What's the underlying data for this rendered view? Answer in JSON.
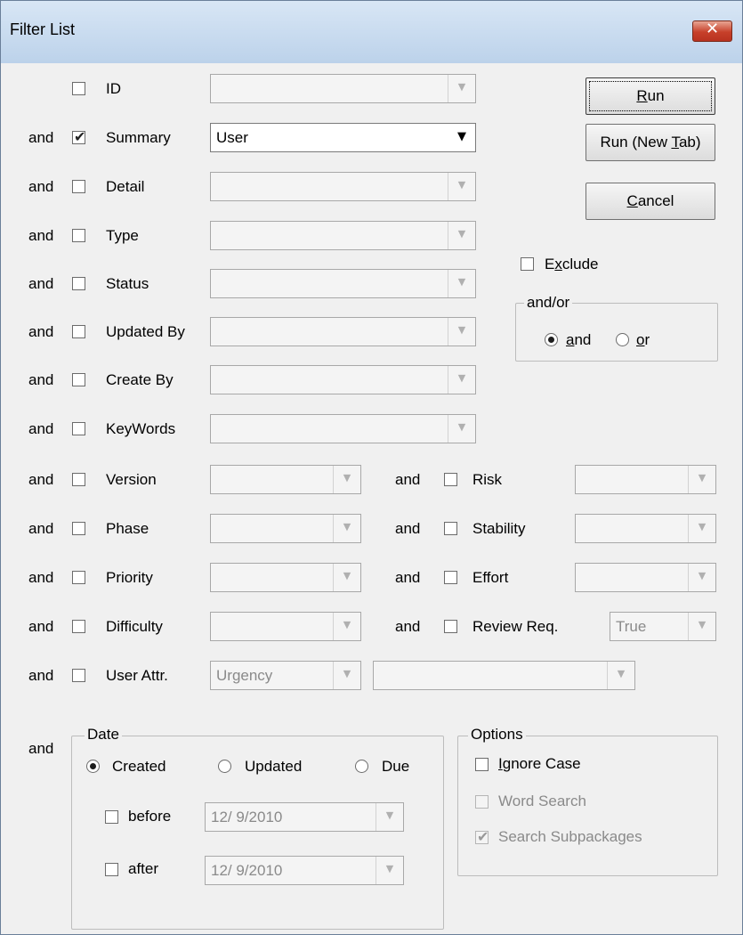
{
  "window": {
    "title": "Filter List",
    "close_glyph": "✕"
  },
  "glyphs": {
    "check": "✔",
    "arrow": "▼"
  },
  "rows": [
    {
      "conj": "",
      "label": "ID",
      "checked": false,
      "value": ""
    },
    {
      "conj": "and",
      "label": "Summary",
      "checked": true,
      "value": "User"
    },
    {
      "conj": "and",
      "label": "Detail",
      "checked": false,
      "value": ""
    },
    {
      "conj": "and",
      "label": "Type",
      "checked": false,
      "value": ""
    },
    {
      "conj": "and",
      "label": "Status",
      "checked": false,
      "value": ""
    },
    {
      "conj": "and",
      "label": "Updated By",
      "checked": false,
      "value": ""
    },
    {
      "conj": "and",
      "label": "Create By",
      "checked": false,
      "value": ""
    },
    {
      "conj": "and",
      "label": "KeyWords",
      "checked": false,
      "value": ""
    }
  ],
  "left_rows": [
    {
      "conj": "and",
      "label": "Version",
      "checked": false,
      "value": ""
    },
    {
      "conj": "and",
      "label": "Phase",
      "checked": false,
      "value": ""
    },
    {
      "conj": "and",
      "label": "Priority",
      "checked": false,
      "value": ""
    },
    {
      "conj": "and",
      "label": "Difficulty",
      "checked": false,
      "value": ""
    }
  ],
  "right_rows": [
    {
      "conj": "and",
      "label": "Risk",
      "checked": false,
      "value": ""
    },
    {
      "conj": "and",
      "label": "Stability",
      "checked": false,
      "value": ""
    },
    {
      "conj": "and",
      "label": "Effort",
      "checked": false,
      "value": ""
    },
    {
      "conj": "and",
      "label": "Review Req.",
      "checked": false,
      "value": "True"
    }
  ],
  "user_attr": {
    "conj": "and",
    "label": "User Attr.",
    "checked": false,
    "attr_value": "Urgency",
    "value": ""
  },
  "buttons": {
    "run": {
      "pre": "",
      "key": "R",
      "post": "un"
    },
    "run_new_tab": {
      "pre": "Run (New ",
      "key": "T",
      "post": "ab)"
    },
    "cancel": {
      "pre": "",
      "key": "C",
      "post": "ancel"
    }
  },
  "exclude": {
    "pre": "",
    "key": "x",
    "label_pre": "E",
    "post": "clude",
    "checked": false
  },
  "andor": {
    "legend": "and/or",
    "and": {
      "key": "a",
      "post": "nd",
      "selected": true
    },
    "or": {
      "key": "o",
      "post": "r",
      "selected": false
    }
  },
  "date": {
    "conj": "and",
    "legend": "Date",
    "created": {
      "label": "Created",
      "selected": true
    },
    "updated": {
      "label": "Updated",
      "selected": false
    },
    "due": {
      "label": "Due",
      "selected": false
    },
    "before": {
      "label": "before",
      "checked": false,
      "value": "12/  9/2010"
    },
    "after": {
      "label": "after",
      "checked": false,
      "value": "12/  9/2010"
    }
  },
  "options": {
    "legend": "Options",
    "ignore_case": {
      "key": "I",
      "post": "gnore Case",
      "checked": false
    },
    "word_search": {
      "label": "Word Search",
      "checked": false,
      "disabled": true
    },
    "search_subpackages": {
      "label": "Search Subpackages",
      "checked": true,
      "disabled": true
    }
  }
}
